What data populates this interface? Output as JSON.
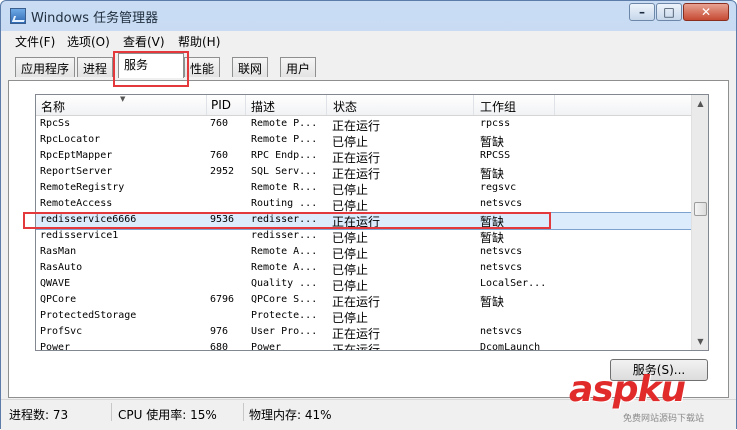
{
  "window": {
    "title": "Windows 任务管理器",
    "controls": {
      "minimize": "–",
      "maximize": "□",
      "close": "✕"
    }
  },
  "menu": [
    "文件(F)",
    "选项(O)",
    "查看(V)",
    "帮助(H)"
  ],
  "tabs": [
    "应用程序",
    "进程",
    "服务",
    "性能",
    "联网",
    "用户"
  ],
  "active_tab": "服务",
  "list": {
    "columns": [
      "名称",
      "PID",
      "描述",
      "状态",
      "工作组"
    ],
    "rows": [
      {
        "name": "RpcSs",
        "pid": "760",
        "desc": "Remote P...",
        "status": "正在运行",
        "group": "rpcss"
      },
      {
        "name": "RpcLocator",
        "pid": "",
        "desc": "Remote P...",
        "status": "已停止",
        "group": "暂缺"
      },
      {
        "name": "RpcEptMapper",
        "pid": "760",
        "desc": "RPC Endp...",
        "status": "正在运行",
        "group": "RPCSS"
      },
      {
        "name": "ReportServer",
        "pid": "2952",
        "desc": "SQL Serv...",
        "status": "正在运行",
        "group": "暂缺"
      },
      {
        "name": "RemoteRegistry",
        "pid": "",
        "desc": "Remote R...",
        "status": "已停止",
        "group": "regsvc"
      },
      {
        "name": "RemoteAccess",
        "pid": "",
        "desc": "Routing ...",
        "status": "已停止",
        "group": "netsvcs"
      },
      {
        "name": "redisservice6666",
        "pid": "9536",
        "desc": "redisser...",
        "status": "正在运行",
        "group": "暂缺",
        "selected": true
      },
      {
        "name": "redisservice1",
        "pid": "",
        "desc": "redisser...",
        "status": "已停止",
        "group": "暂缺"
      },
      {
        "name": "RasMan",
        "pid": "",
        "desc": "Remote A...",
        "status": "已停止",
        "group": "netsvcs"
      },
      {
        "name": "RasAuto",
        "pid": "",
        "desc": "Remote A...",
        "status": "已停止",
        "group": "netsvcs"
      },
      {
        "name": "QWAVE",
        "pid": "",
        "desc": "Quality ...",
        "status": "已停止",
        "group": "LocalSer..."
      },
      {
        "name": "QPCore",
        "pid": "6796",
        "desc": "QPCore S...",
        "status": "正在运行",
        "group": "暂缺"
      },
      {
        "name": "ProtectedStorage",
        "pid": "",
        "desc": "Protecte...",
        "status": "已停止",
        "group": ""
      },
      {
        "name": "ProfSvc",
        "pid": "976",
        "desc": "User Pro...",
        "status": "正在运行",
        "group": "netsvcs"
      },
      {
        "name": "Power",
        "pid": "680",
        "desc": "Power",
        "status": "正在运行",
        "group": "DcomLaunch"
      }
    ]
  },
  "services_button": "服务(S)...",
  "status": {
    "processes": "进程数: 73",
    "cpu": "CPU 使用率: 15%",
    "memory": "物理内存: 41%"
  },
  "watermark": {
    "main": "aspku",
    "sub": "免费网站源码下载站"
  },
  "colors": {
    "highlight": "#e4393c",
    "selection": "#dcecfc",
    "title_bg": "#c9dcf3"
  }
}
